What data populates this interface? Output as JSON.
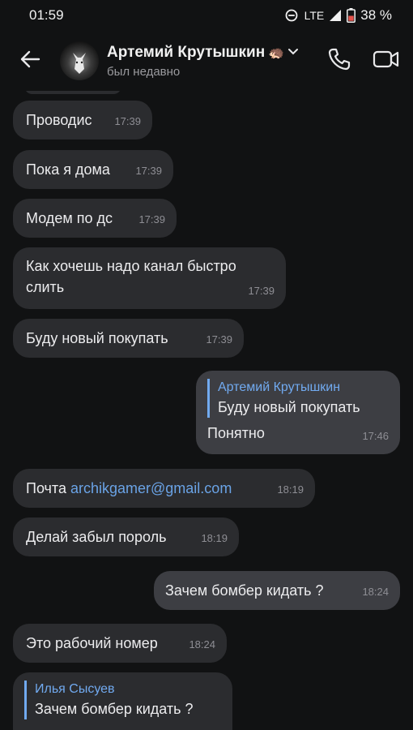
{
  "status_bar": {
    "time": "01:59",
    "network": "LTE",
    "battery": "38 %"
  },
  "header": {
    "name": "Артемий Крутышкин",
    "emoji": "🦔",
    "status": "был недавно",
    "icons": [
      "back-arrow-icon",
      "phone-icon",
      "video-camera-icon",
      "chevron-down-icon"
    ]
  },
  "messages": [
    {
      "dir": "in",
      "text": "Проводис",
      "time": "17:39"
    },
    {
      "dir": "in",
      "text": "Пока я дома",
      "time": "17:39"
    },
    {
      "dir": "in",
      "text": "Модем по дс",
      "time": "17:39"
    },
    {
      "dir": "in",
      "text_line1": "Как хочешь надо канал быстро",
      "text_line2": "слить",
      "time": "17:39"
    },
    {
      "dir": "in",
      "text": "Буду новый покупать",
      "time": "17:39"
    },
    {
      "dir": "out",
      "reply_author": "Артемий Крутышкин",
      "reply_text": "Буду новый покупать",
      "text": "Понятно",
      "time": "17:46"
    },
    {
      "dir": "in",
      "prefix": "Почта ",
      "link": "archikgamer@gmail.com",
      "time": "18:19"
    },
    {
      "dir": "in",
      "text": "Делай забыл пороль",
      "time": "18:19"
    },
    {
      "dir": "out",
      "text": "Зачем бомбер кидать ?",
      "time": "18:24"
    },
    {
      "dir": "in",
      "text": "Это рабочий номер",
      "time": "18:24"
    },
    {
      "dir": "in",
      "reply_author": "Илья Сысуев",
      "reply_text": "Зачем бомбер кидать ?"
    }
  ],
  "colors": {
    "background": "#111213",
    "incoming": "#2b2c2f",
    "outgoing": "#3d3e43",
    "accent": "#71aaf0"
  }
}
